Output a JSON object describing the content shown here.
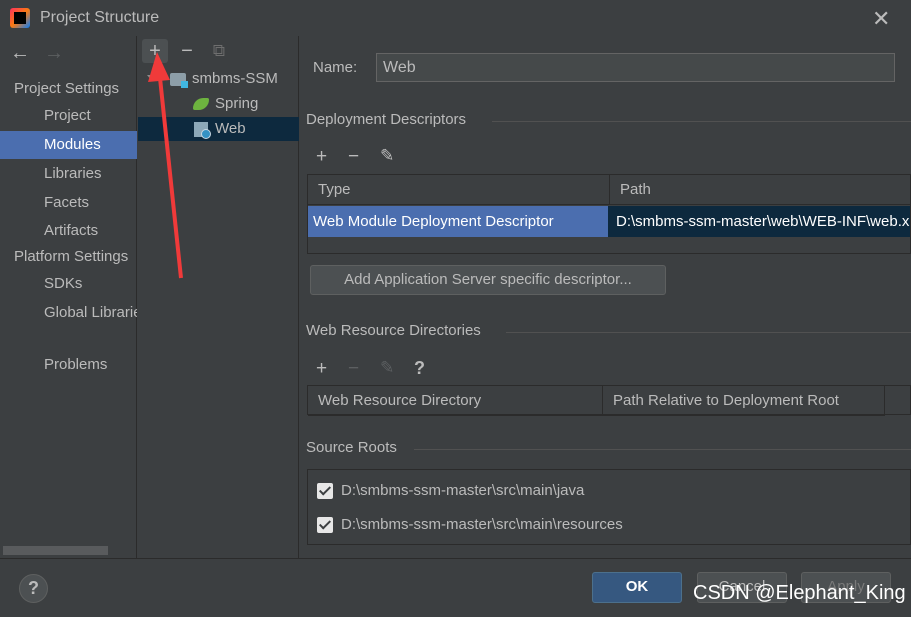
{
  "window": {
    "title": "Project Structure"
  },
  "left_nav": {
    "project_settings_header": "Project Settings",
    "items": [
      {
        "label": "Project"
      },
      {
        "label": "Modules",
        "selected": true
      },
      {
        "label": "Libraries"
      },
      {
        "label": "Facets"
      },
      {
        "label": "Artifacts"
      }
    ],
    "platform_settings_header": "Platform Settings",
    "platform_items": [
      {
        "label": "SDKs"
      },
      {
        "label": "Global Libraries"
      }
    ],
    "problems_label": "Problems"
  },
  "tree": {
    "toolbar": {
      "add": "+",
      "remove": "−",
      "copy": "⧉"
    },
    "nodes": [
      {
        "label": "smbms-SSM",
        "icon": "module-folder-icon"
      },
      {
        "label": "Spring",
        "icon": "spring-icon"
      },
      {
        "label": "Web",
        "icon": "web-facet-icon",
        "selected": true
      }
    ]
  },
  "main": {
    "name_label": "Name:",
    "name_value": "Web",
    "deployment_descriptors": {
      "header": "Deployment Descriptors",
      "columns": [
        "Type",
        "Path"
      ],
      "rows": [
        {
          "type": "Web Module Deployment Descriptor",
          "path": "D:\\smbms-ssm-master\\web\\WEB-INF\\web.xml"
        }
      ],
      "add_server_descriptor_button": "Add Application Server specific descriptor..."
    },
    "web_resource_directories": {
      "header": "Web Resource Directories",
      "columns": [
        "Web Resource Directory",
        "Path Relative to Deployment Root"
      ],
      "help": "?"
    },
    "source_roots": {
      "header": "Source Roots",
      "items": [
        {
          "path": "D:\\smbms-ssm-master\\src\\main\\java",
          "checked": true
        },
        {
          "path": "D:\\smbms-ssm-master\\src\\main\\resources",
          "checked": true
        }
      ]
    }
  },
  "footer": {
    "help": "?",
    "ok": "OK",
    "cancel": "Cancel",
    "apply": "Apply"
  },
  "watermark": "CSDN @Elephant_King",
  "colors": {
    "accent": "#4b6eaf",
    "selection_dark": "#0d293e",
    "arrow": "#f03a3a"
  }
}
